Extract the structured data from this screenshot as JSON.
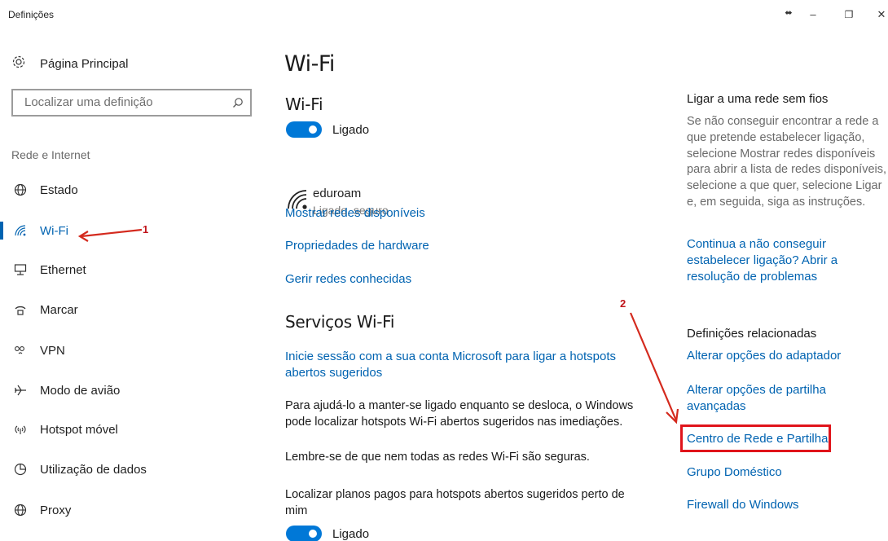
{
  "window": {
    "title": "Definições",
    "controls": {
      "restore_arrows": "⬌",
      "minimize": "–",
      "maximize": "❐",
      "close": "✕"
    }
  },
  "sidebar": {
    "home_label": "Página Principal",
    "search_placeholder": "Localizar uma definição",
    "section_label": "Rede e Internet",
    "items": [
      {
        "label": "Estado",
        "icon": "globe-icon"
      },
      {
        "label": "Wi-Fi",
        "icon": "wifi-icon",
        "active": true
      },
      {
        "label": "Ethernet",
        "icon": "ethernet-icon"
      },
      {
        "label": "Marcar",
        "icon": "dialup-icon"
      },
      {
        "label": "VPN",
        "icon": "vpn-icon"
      },
      {
        "label": "Modo de avião",
        "icon": "airplane-icon"
      },
      {
        "label": "Hotspot móvel",
        "icon": "hotspot-icon"
      },
      {
        "label": "Utilização de dados",
        "icon": "data-usage-icon"
      },
      {
        "label": "Proxy",
        "icon": "proxy-globe-icon"
      }
    ]
  },
  "main": {
    "page_title": "Wi-Fi",
    "wifi_section": {
      "heading": "Wi-Fi",
      "toggle_label": "Ligado",
      "network_name": "eduroam",
      "network_status": "Ligado, seguro",
      "links": [
        "Mostrar redes disponíveis",
        "Propriedades de hardware",
        "Gerir redes conhecidas"
      ]
    },
    "services_section": {
      "heading": "Serviços Wi-Fi",
      "signin_link": "Inicie sessão com a sua conta Microsoft para ligar a hotspots abertos sugeridos",
      "para1": "Para ajudá-lo a manter-se ligado enquanto se desloca, o Windows pode localizar hotspots Wi-Fi abertos sugeridos nas imediações.",
      "para2": "Lembre-se de que nem todas as redes Wi-Fi são seguras.",
      "para3": "Localizar planos pagos para hotspots abertos sugeridos perto de mim",
      "toggle_label": "Ligado"
    }
  },
  "right": {
    "connect_title": "Ligar a uma rede sem fios",
    "connect_text": "Se não conseguir encontrar a rede a que pretende estabelecer ligação, selecione Mostrar redes disponíveis para abrir a lista de redes disponíveis, selecione a que quer, selecione Ligar e, em seguida, siga as instruções.",
    "troubleshoot_link": "Continua a não conseguir estabelecer ligação? Abrir a resolução de problemas",
    "related_title": "Definições relacionadas",
    "related_links": [
      "Alterar opções do adaptador",
      "Alterar opções de partilha avançadas",
      "Centro de Rede e Partilha",
      "Grupo Doméstico",
      "Firewall do Windows"
    ]
  },
  "annotations": {
    "marker1": "1",
    "marker2": "2"
  },
  "colors": {
    "accent": "#0063b1",
    "toggle_on": "#0078d7",
    "annotation": "#e0141b"
  }
}
